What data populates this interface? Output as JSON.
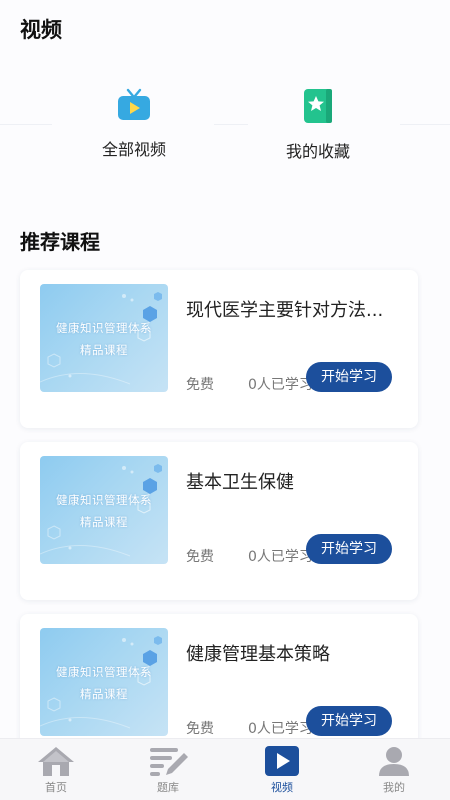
{
  "header": {
    "title": "视频"
  },
  "quick_links": [
    {
      "label": "全部视频",
      "icon": "tv-icon",
      "color": "#36a9e1"
    },
    {
      "label": "我的收藏",
      "icon": "bookmark-star-icon",
      "color": "#23c38e"
    }
  ],
  "section": {
    "title": "推荐课程"
  },
  "courses": [
    {
      "thumb_line1": "健康知识管理体系",
      "thumb_line2": "精品课程",
      "title": "现代医学主要针对方法...",
      "price": "免费",
      "students": "0人已学习",
      "button": "开始学习"
    },
    {
      "thumb_line1": "健康知识管理体系",
      "thumb_line2": "精品课程",
      "title": "基本卫生保健",
      "price": "免费",
      "students": "0人已学习",
      "button": "开始学习"
    },
    {
      "thumb_line1": "健康知识管理体系",
      "thumb_line2": "精品课程",
      "title": "健康管理基本策略",
      "price": "免费",
      "students": "0人已学习",
      "button": "开始学习"
    }
  ],
  "tabbar": {
    "items": [
      {
        "label": "首页",
        "icon": "home-icon"
      },
      {
        "label": "题库",
        "icon": "question-bank-icon"
      },
      {
        "label": "视频",
        "icon": "play-icon",
        "active": true
      },
      {
        "label": "我的",
        "icon": "user-icon"
      }
    ],
    "active_color": "#1c4f9c"
  }
}
